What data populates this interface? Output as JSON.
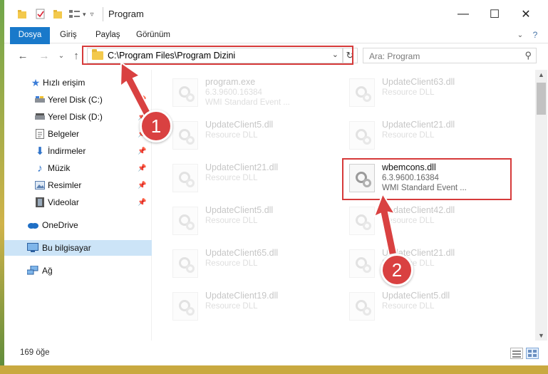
{
  "window": {
    "title": "Program",
    "buttons": {
      "minimize": "—",
      "maximize": "☐",
      "close": "✕"
    }
  },
  "ribbon": {
    "tabs": [
      "Dosya",
      "Giriş",
      "Paylaş",
      "Görünüm"
    ]
  },
  "address": {
    "path": "C:\\Program Files\\Program Dizini",
    "search_placeholder": "Ara: Program"
  },
  "nav": {
    "items": [
      {
        "label": "Hızlı erişim",
        "icon": "star-icon"
      },
      {
        "label": "Yerel Disk (C:)",
        "icon": "drive-icon",
        "pinned": true
      },
      {
        "label": "Yerel Disk (D:)",
        "icon": "drive-icon",
        "pinned": true
      },
      {
        "label": "Belgeler",
        "icon": "documents-icon",
        "pinned": true
      },
      {
        "label": "İndirmeler",
        "icon": "download-icon",
        "pinned": true
      },
      {
        "label": "Müzik",
        "icon": "music-icon",
        "pinned": true
      },
      {
        "label": "Resimler",
        "icon": "pictures-icon",
        "pinned": true
      },
      {
        "label": "Videolar",
        "icon": "videos-icon",
        "pinned": true
      },
      {
        "label": "OneDrive",
        "icon": "cloud-icon"
      },
      {
        "label": "Bu bilgisayar",
        "icon": "computer-icon",
        "selected": true
      },
      {
        "label": "Ağ",
        "icon": "network-icon"
      }
    ]
  },
  "files": [
    {
      "name": "program.exe",
      "sub1": "6.3.9600.16384",
      "sub2": "WMI Standard Event ..."
    },
    {
      "name": "UpdateClient63.dll",
      "sub1": "Resource DLL",
      "sub2": ""
    },
    {
      "name": "UpdateClient5.dll",
      "sub1": "Resource DLL",
      "sub2": ""
    },
    {
      "name": "UpdateClient21.dll",
      "sub1": "Resource DLL",
      "sub2": ""
    },
    {
      "name": "UpdateClient21.dll",
      "sub1": "Resource DLL",
      "sub2": ""
    },
    {
      "name": "wbemcons.dll",
      "sub1": "6.3.9600.16384",
      "sub2": "WMI Standard Event ...",
      "highlighted": true
    },
    {
      "name": "UpdateClient5.dll",
      "sub1": "Resource DLL",
      "sub2": ""
    },
    {
      "name": "UpdateClient42.dll",
      "sub1": "Resource DLL",
      "sub2": ""
    },
    {
      "name": "UpdateClient65.dll",
      "sub1": "Resource DLL",
      "sub2": ""
    },
    {
      "name": "UpdateClient21.dll",
      "sub1": "Resource DLL",
      "sub2": ""
    },
    {
      "name": "UpdateClient19.dll",
      "sub1": "Resource DLL",
      "sub2": ""
    },
    {
      "name": "UpdateClient5.dll",
      "sub1": "Resource DLL",
      "sub2": ""
    }
  ],
  "status": {
    "count": "169 öğe"
  },
  "annotations": {
    "badge1": "1",
    "badge2": "2",
    "accent": "#d94141"
  }
}
